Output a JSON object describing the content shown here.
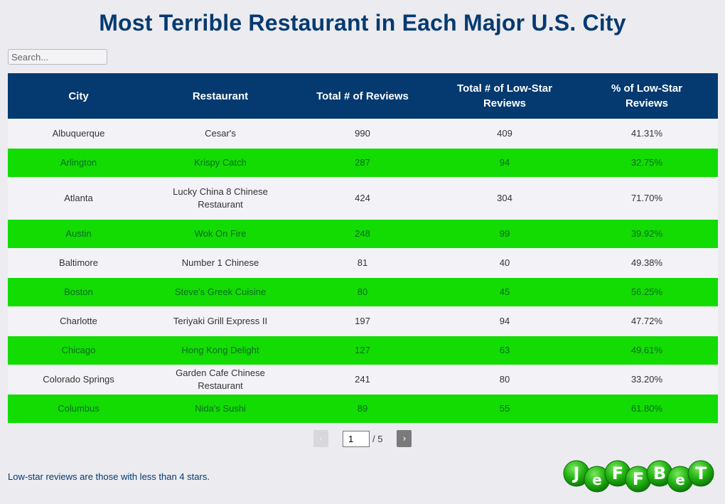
{
  "page": {
    "title": "Most Terrible Restaurant in Each Major U.S. City",
    "search_placeholder": "Search...",
    "search_value": "",
    "footnote": "Low-star reviews are those with less than 4 stars."
  },
  "table": {
    "columns": [
      "City",
      "Restaurant",
      "Total # of Reviews",
      "Total # of Low-Star Reviews",
      "% of Low-Star Reviews"
    ],
    "rows": [
      [
        "Albuquerque",
        "Cesar's",
        "990",
        "409",
        "41.31%"
      ],
      [
        "Arlington",
        "Krispy Catch",
        "287",
        "94",
        "32.75%"
      ],
      [
        "Atlanta",
        "Lucky China 8 Chinese Restaurant",
        "424",
        "304",
        "71.70%"
      ],
      [
        "Austin",
        "Wok On Fire",
        "248",
        "99",
        "39.92%"
      ],
      [
        "Baltimore",
        "Number 1 Chinese",
        "81",
        "40",
        "49.38%"
      ],
      [
        "Boston",
        "Steve's Greek Cuisine",
        "80",
        "45",
        "56.25%"
      ],
      [
        "Charlotte",
        "Teriyaki Grill Express II",
        "197",
        "94",
        "47.72%"
      ],
      [
        "Chicago",
        "Hong Kong Delight",
        "127",
        "63",
        "49.61%"
      ],
      [
        "Colorado Springs",
        "Garden Cafe Chinese Restaurant",
        "241",
        "80",
        "33.20%"
      ],
      [
        "Columbus",
        "Nida's Sushi",
        "89",
        "55",
        "61.80%"
      ]
    ]
  },
  "pagination": {
    "prev_icon": "‹",
    "next_icon": "›",
    "current_page": "1",
    "total_label": "/ 5"
  },
  "logo": {
    "letters": [
      "J",
      "e",
      "F",
      "F",
      "B",
      "e",
      "T"
    ],
    "color": "#1fa80e"
  }
}
